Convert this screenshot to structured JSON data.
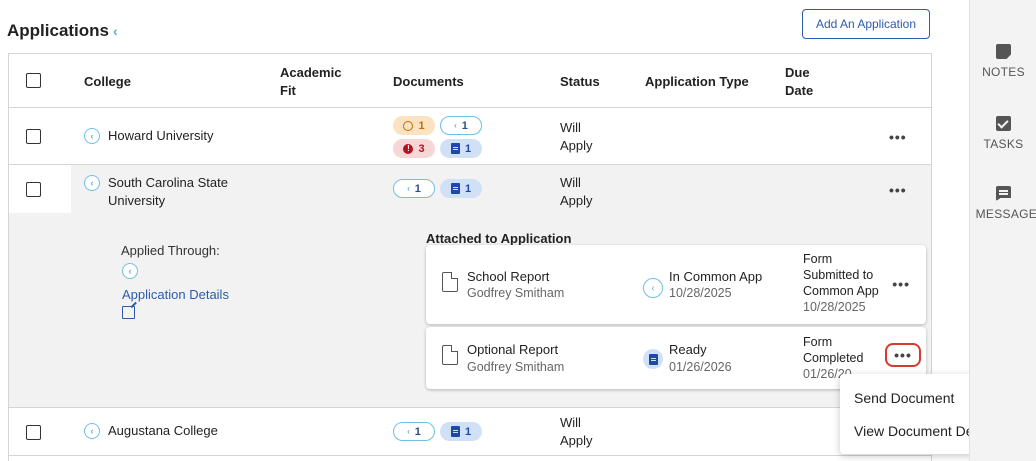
{
  "header": {
    "title": "Applications",
    "add_button": "Add An Application"
  },
  "table": {
    "columns": {
      "college": "College",
      "academic_fit_1": "Academic",
      "academic_fit_2": "Fit",
      "documents": "Documents",
      "status": "Status",
      "application_type": "Application Type",
      "due_date_1": "Due",
      "due_date_2": "Date"
    },
    "rows": [
      {
        "college": "Howard University",
        "status_1": "Will",
        "status_2": "Apply",
        "docs": {
          "pending": "1",
          "commonapp": "1",
          "errors": "3",
          "files": "1"
        }
      },
      {
        "college_1": "South Carolina State",
        "college_2": "University",
        "status_1": "Will",
        "status_2": "Apply",
        "docs": {
          "commonapp": "1",
          "files": "1"
        }
      },
      {
        "college": "Augustana College",
        "status_1": "Will",
        "status_2": "Apply",
        "docs": {
          "commonapp": "1",
          "files": "1"
        }
      }
    ],
    "more_label": "•••"
  },
  "detail": {
    "applied_through": "Applied Through:",
    "application_details": "Application Details",
    "attached_label": "Attached to Application",
    "documents": [
      {
        "name": "School Report",
        "person": "Godfrey Smitham",
        "status": "In Common App",
        "status_date": "10/28/2025",
        "form_1": "Form",
        "form_2": "Submitted to",
        "form_3": "Common App",
        "form_date": "10/28/2025"
      },
      {
        "name": "Optional Report",
        "person": "Godfrey Smitham",
        "status": "Ready",
        "status_date": "01/26/2026",
        "form_1": "Form",
        "form_2": "Completed",
        "form_date": "01/26/20"
      }
    ]
  },
  "context_menu": {
    "items": [
      "Send Document",
      "View Document Details"
    ]
  },
  "rail": {
    "items": [
      "NOTES",
      "TASKS",
      "MESSAGES"
    ]
  },
  "colors": {
    "accent": "#2b5cad",
    "highlight": "#d63a2f",
    "commonapp": "#6ec1e4"
  }
}
